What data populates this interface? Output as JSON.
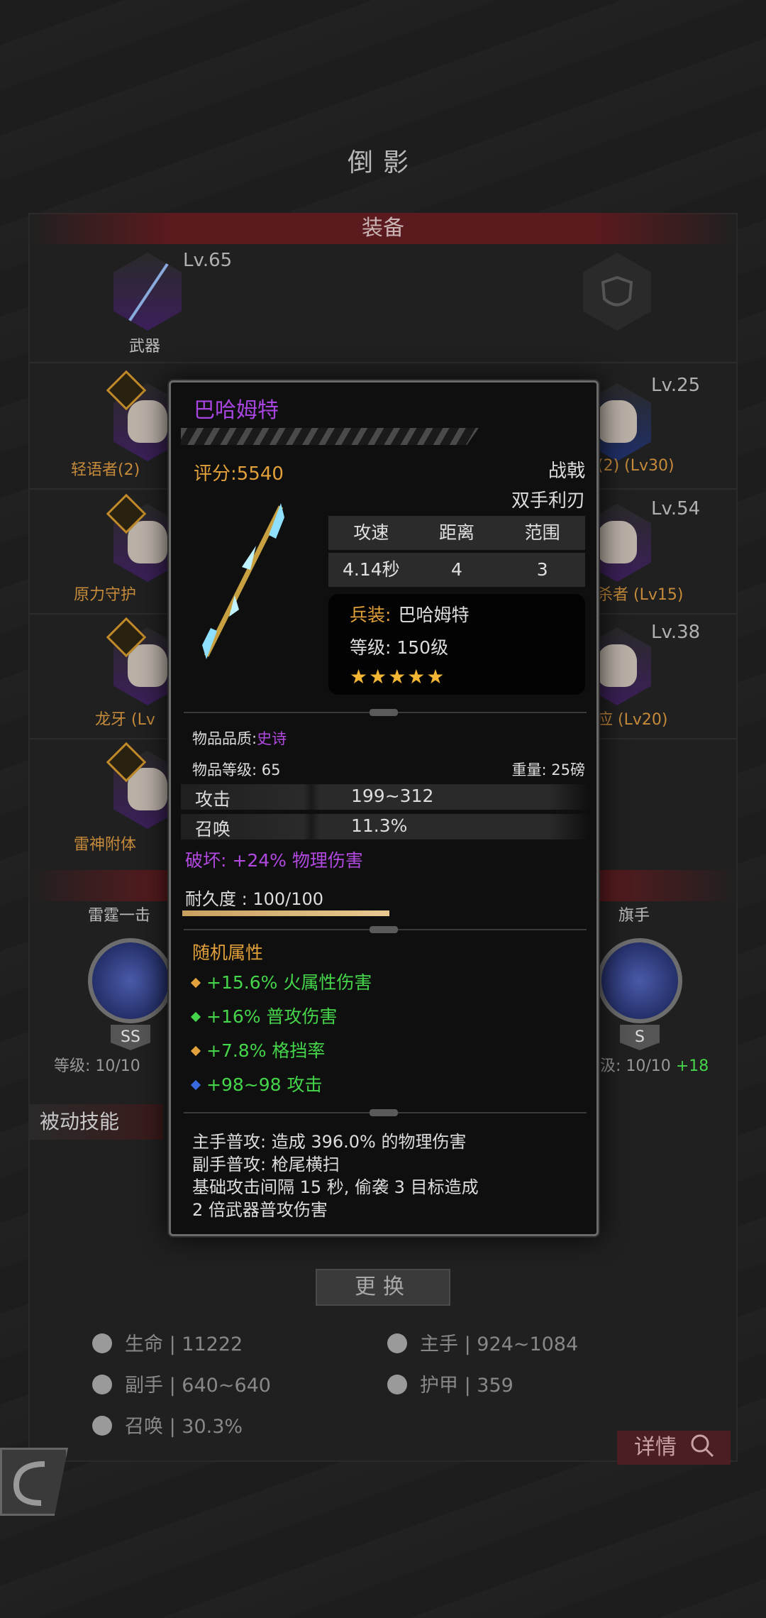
{
  "screen": {
    "title": "倒影",
    "equip_header": "装备",
    "weapon_level": "Lv.65",
    "weapon_label": "武器",
    "slots": [
      {
        "name": "轻语者(2)",
        "level": "Lv.25",
        "right_name": "(2)  (Lv30)"
      },
      {
        "name": "原力守护",
        "level": "Lv.54",
        "right_name": "杀者 (Lv15)"
      },
      {
        "name": "龙牙 (Lv",
        "level": "Lv.38",
        "right_name": "应 (Lv20)"
      },
      {
        "name": "雷神附体",
        "level": "",
        "right_name": ""
      }
    ],
    "skills": {
      "left_name": "雷霆一击",
      "left_grade": "SS",
      "left_level": "等级: 10/10",
      "right_name": "旗手",
      "right_grade": "S",
      "right_level": "汲: 10/10",
      "right_bonus": "+18"
    },
    "passive_tab": "被动技能",
    "change_button": "更换",
    "stats": {
      "hp_label": "生命",
      "hp_value": "11222",
      "main_label": "主手",
      "main_value": "924~1084",
      "off_label": "副手",
      "off_value": "640~640",
      "armor_label": "护甲",
      "armor_value": "359",
      "summon_label": "召唤",
      "summon_value": "30.3%"
    },
    "separator": "|",
    "detail_button": "详情"
  },
  "popup": {
    "name": "巴哈姆特",
    "score": "评分:5540",
    "type": "战戟",
    "subtype": "双手利刃",
    "table_headers": [
      "攻速",
      "距离",
      "范围"
    ],
    "table_values": [
      "4.14秒",
      "4",
      "3"
    ],
    "soldier_key": "兵装:",
    "soldier_value": "巴哈姆特",
    "soldier_level": "等级: 150级",
    "stars": "★★★★★",
    "quality_label": "物品品质:",
    "quality_value": "史诗",
    "item_level": "物品等级: 65",
    "weight": "重量: 25磅",
    "attack_label": "攻击",
    "attack_value": "199~312",
    "summon_label": "召唤",
    "summon_value": "11.3%",
    "break_line": "破坏: +24% 物理伤害",
    "durability": "耐久度 : 100/100",
    "durability_fraction": 1.0,
    "random_title": "随机属性",
    "random_attrs": [
      {
        "text": "+15.6% 火属性伤害",
        "dot": "#e2a13a"
      },
      {
        "text": "+16% 普攻伤害",
        "dot": "#45d54a"
      },
      {
        "text": "+7.8% 格挡率",
        "dot": "#e2a13a"
      },
      {
        "text": "+98~98 攻击",
        "dot": "#3a6ae0"
      }
    ],
    "desc_lines": [
      "主手普攻: 造成 396.0% 的物理伤害",
      "副手普攻: 枪尾横扫",
      "基础攻击间隔 15 秒, 偷袭 3 目标造成",
      "2 倍武器普攻伤害"
    ]
  },
  "colors": {
    "epic": "#a845e0",
    "gold": "#e2a13a",
    "green": "#45d54a"
  }
}
